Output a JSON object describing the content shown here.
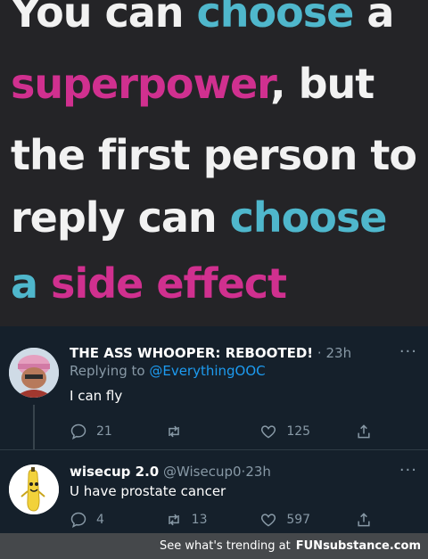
{
  "meme": {
    "lines": [
      [
        {
          "t": "You can ",
          "c": "w"
        },
        {
          "t": "choose",
          "c": "b"
        },
        {
          "t": " a",
          "c": "w"
        }
      ],
      [
        {
          "t": "superpower",
          "c": "p"
        },
        {
          "t": ", but",
          "c": "w"
        }
      ],
      [
        {
          "t": "the first person to",
          "c": "w"
        }
      ],
      [
        {
          "t": "reply can ",
          "c": "w"
        },
        {
          "t": "choose",
          "c": "b"
        }
      ],
      [
        {
          "t": "a",
          "c": "b"
        },
        {
          "t": " side effect",
          "c": "p"
        }
      ]
    ]
  },
  "tweets": [
    {
      "name": "THE ASS WHOOPER: REBOOTED!",
      "handle": "",
      "dot": "·",
      "time": "23h",
      "replying_prefix": "Replying to ",
      "replying_to": "@EverythingOOC",
      "text": "I can fly",
      "replies": "21",
      "retweets": "",
      "likes": "125",
      "more": "···",
      "avatar": "tf2-heavy-pink-helmet-avatar"
    },
    {
      "name": "wisecup 2.0",
      "handle": "@Wisecup0",
      "dot": "·",
      "time": "23h",
      "text": "U have prostate cancer",
      "replies": "4",
      "retweets": "13",
      "likes": "597",
      "more": "···",
      "avatar": "peanut-butter-banana-avatar"
    }
  ],
  "footer": {
    "text": "See what's trending at",
    "brand": "FUNsubstance.com"
  },
  "colors": {
    "meme_bg": "#242427",
    "cyan": "#4fb7cc",
    "magenta": "#d0308f",
    "tweet_bg": "#15202b",
    "mention": "#1d9bf0",
    "muted": "#8899a6"
  }
}
